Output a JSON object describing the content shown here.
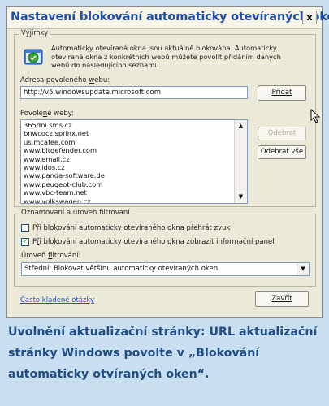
{
  "window": {
    "title": "Nastavení blokování automaticky otevíraných oken",
    "close_label": "x"
  },
  "exceptions": {
    "legend": "Výjimky",
    "description": "Automaticky otevíraná okna jsou aktuálně blokována. Automaticky otevíraná okna z konkrétních webů můžete povolit přidáním daných webů do následujícího seznamu.",
    "address_label": "Adresa povoleného webu:",
    "address_value": "http://v5.windowsupdate.microsoft.com",
    "add_button": "Přidat",
    "allowed_label": "Povolené weby:",
    "allowed_sites": [
      "365dni.sms.cz",
      "bnwcocz.sprinx.net",
      "us.mcafee.com",
      "www.bitdefender.com",
      "www.email.cz",
      "www.idos.cz",
      "www.panda-software.de",
      "www.peugeot-club.com",
      "www.vbc-team.net",
      "www.volkswagen.cz"
    ],
    "remove_button": "Odebrat",
    "remove_all_button": "Odebrat vše"
  },
  "notifications": {
    "legend": "Oznamování a úroveň filtrování",
    "play_sound": {
      "label": "Při blokování automaticky otevíraného okna přehrát zvuk",
      "checked": false
    },
    "show_bar": {
      "label": "Při blokování automaticky otevíraného okna zobrazit informační panel",
      "checked": true
    },
    "filter_label": "Úroveň filtrování:",
    "filter_value": "Střední: Blokovat většinu automaticky otevíraných oken"
  },
  "footer": {
    "faq_link": "Často kladené otázky",
    "close_button": "Zavřít"
  },
  "caption": "Uvolnění aktualizační stránky: URL aktualizační stránky Windows povolte v „Blokování automaticky otvíraných oken“.",
  "colors": {
    "page_background": "#c9dff1",
    "caption_text": "#1f4e86",
    "title_text": "#1a4fa8"
  }
}
